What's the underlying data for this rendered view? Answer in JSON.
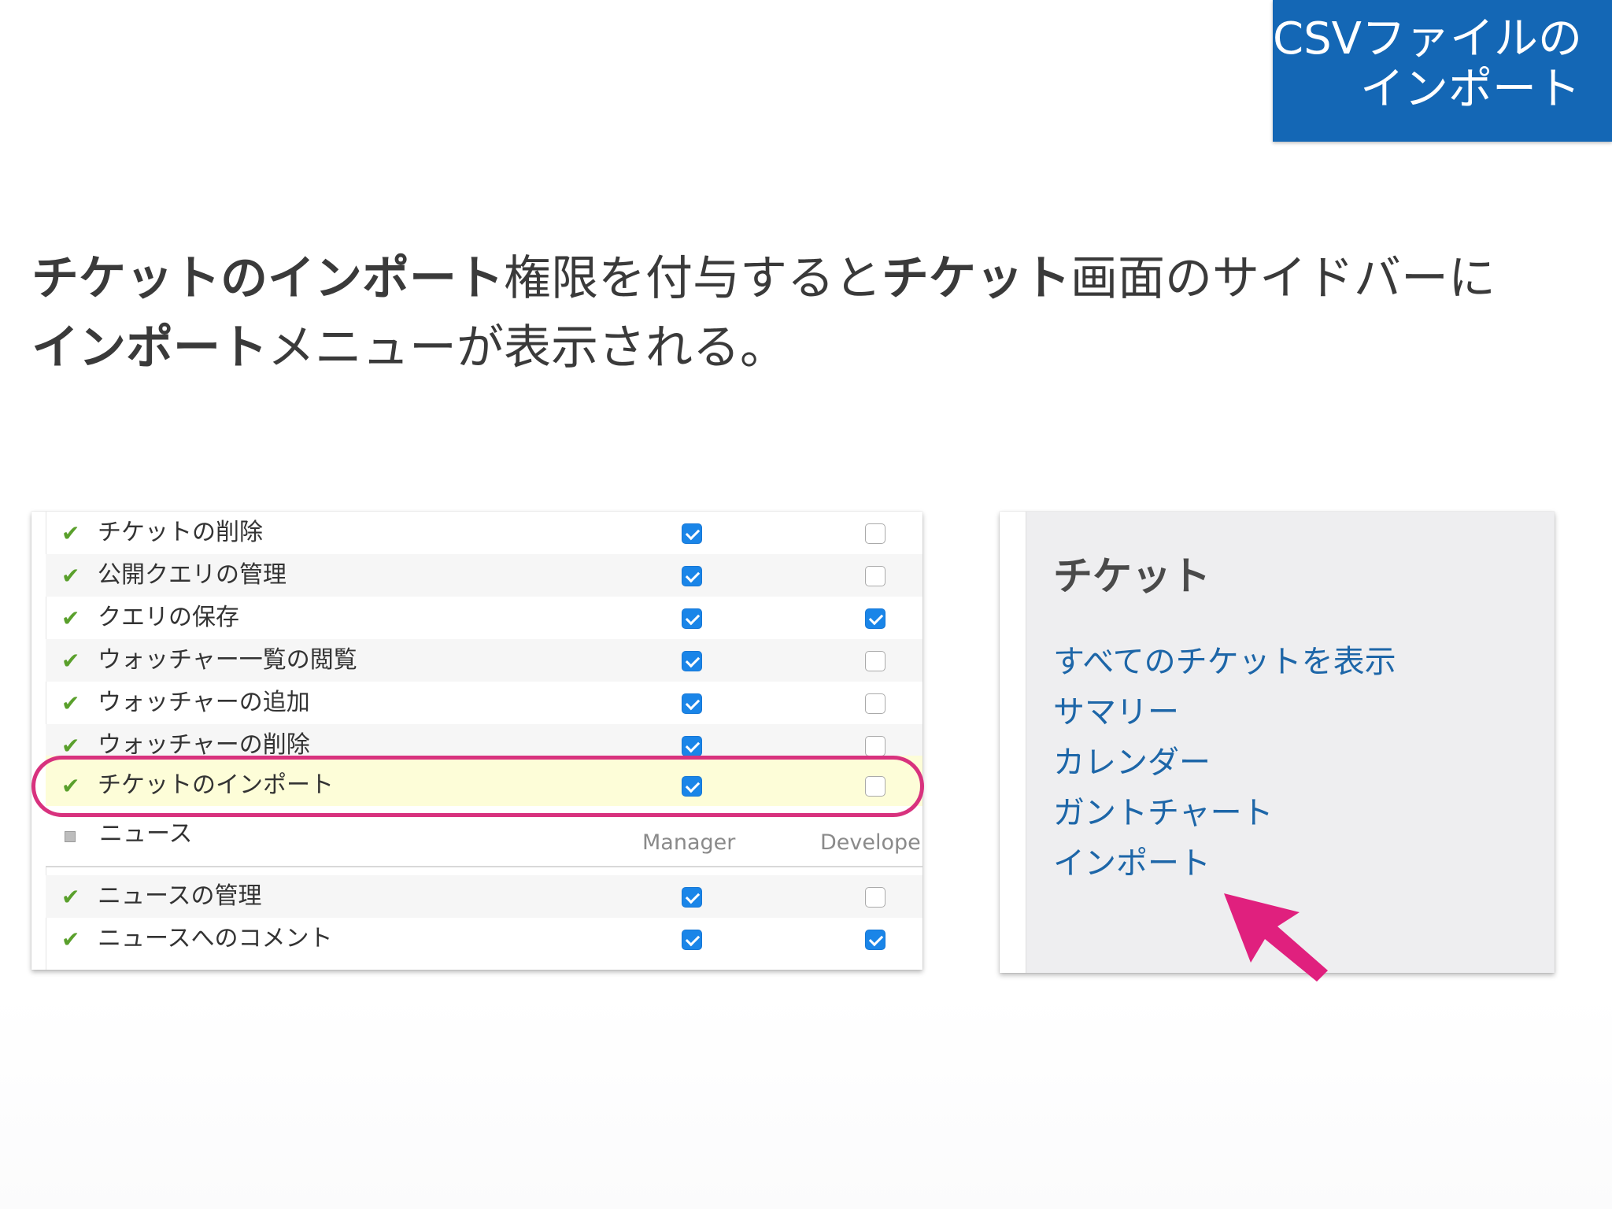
{
  "badge": {
    "line1": "CSVファイルの",
    "line2": "インポート",
    "color": "#1467b5"
  },
  "description": {
    "line1": [
      {
        "text": "チケットのインポート",
        "bold": true
      },
      {
        "text": "権限を付与すると",
        "bold": false
      },
      {
        "text": "チケット",
        "bold": true
      },
      {
        "text": "画面のサイドバーに",
        "bold": false
      }
    ],
    "line2": [
      {
        "text": "インポート",
        "bold": true
      },
      {
        "text": "メニューが表示される。",
        "bold": false
      }
    ]
  },
  "permissions": {
    "rows": [
      {
        "label": "チケットの削除",
        "manager": true,
        "developer": false
      },
      {
        "label": "公開クエリの管理",
        "manager": true,
        "developer": false
      },
      {
        "label": "クエリの保存",
        "manager": true,
        "developer": true
      },
      {
        "label": "ウォッチャー一覧の閲覧",
        "manager": true,
        "developer": false
      },
      {
        "label": "ウォッチャーの追加",
        "manager": true,
        "developer": false
      },
      {
        "label": "ウォッチャーの削除",
        "manager": true,
        "developer": false
      },
      {
        "label": "チケットのインポート",
        "manager": true,
        "developer": false,
        "highlighted": true
      }
    ],
    "news_section": {
      "label": "ニュース",
      "column_manager": "Manager",
      "column_developer": "Developer"
    },
    "news_rows": [
      {
        "label": "ニュースの管理",
        "manager": true,
        "developer": false
      },
      {
        "label": "ニュースへのコメント",
        "manager": true,
        "developer": true
      }
    ],
    "highlight_color": "#d8327e"
  },
  "sidebar": {
    "title": "チケット",
    "links": [
      "すべてのチケットを表示",
      "サマリー",
      "カレンダー",
      "ガントチャート",
      "インポート"
    ],
    "link_color": "#1d66a8"
  },
  "icons": {
    "granted": "check-icon",
    "section": "square-icon",
    "pointer": "arrow-icon"
  }
}
